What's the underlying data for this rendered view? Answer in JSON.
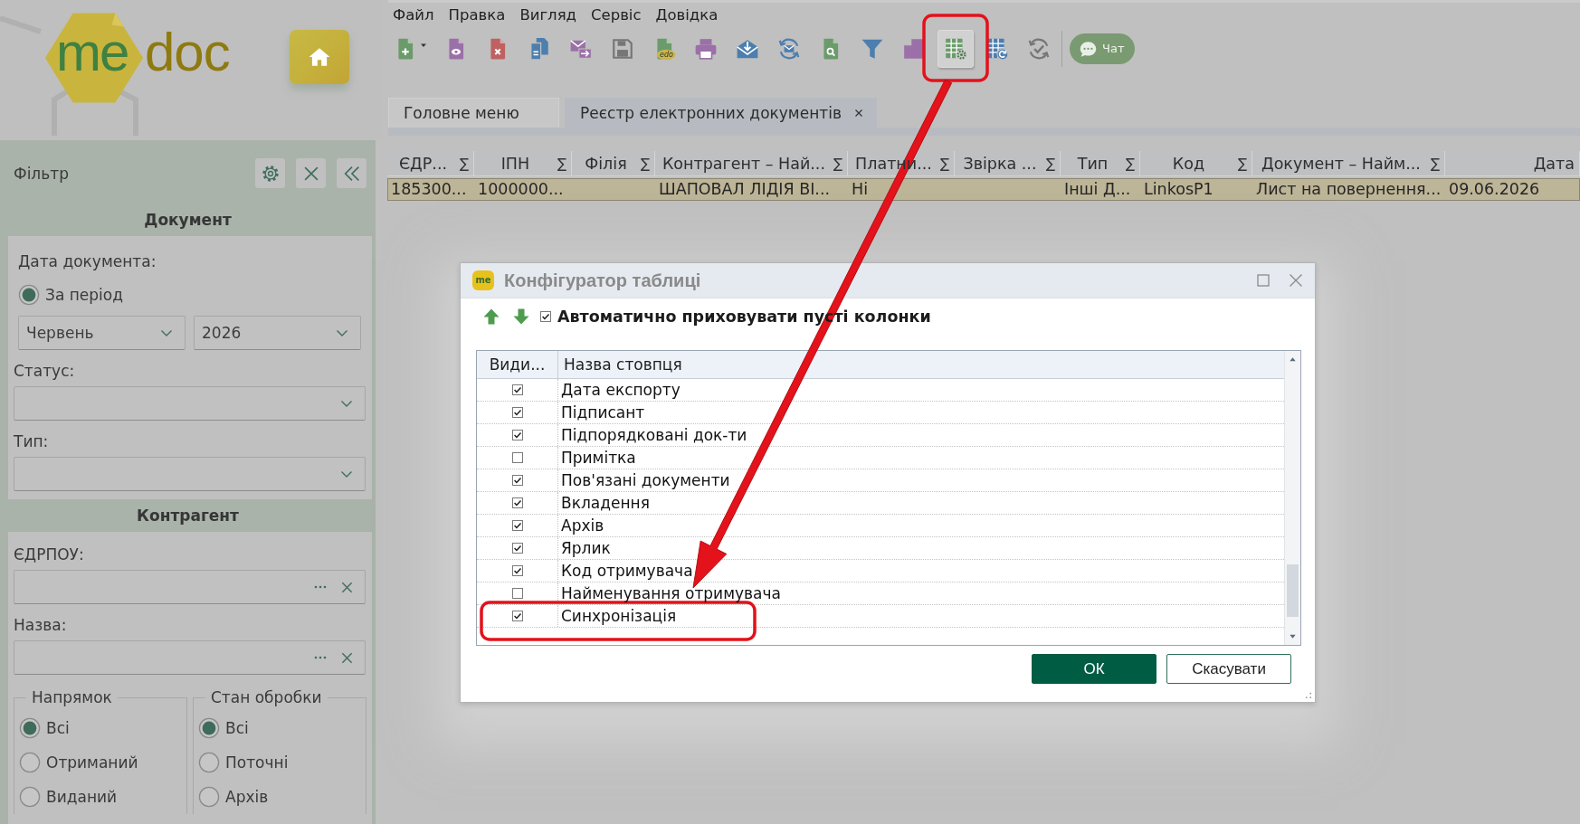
{
  "logo": {
    "primary": "me",
    "secondary": "doc"
  },
  "menu": [
    {
      "label": "Файл"
    },
    {
      "label": "Правка"
    },
    {
      "label": "Вигляд"
    },
    {
      "label": "Сервіс"
    },
    {
      "label": "Довідка"
    }
  ],
  "toolbar": [
    {
      "kind": "new-document",
      "pressed": false,
      "dropdown": true
    },
    {
      "kind": "view-document",
      "pressed": false,
      "dropdown": false
    },
    {
      "kind": "delete-document",
      "pressed": false,
      "dropdown": false
    },
    {
      "kind": "copy-document",
      "pressed": false,
      "dropdown": false
    },
    {
      "kind": "forward-mail",
      "pressed": false,
      "dropdown": false
    },
    {
      "kind": "save",
      "pressed": false,
      "dropdown": false
    },
    {
      "kind": "edo-document",
      "pressed": false,
      "dropdown": false,
      "label": "edo"
    },
    {
      "kind": "print",
      "pressed": false,
      "dropdown": false
    },
    {
      "kind": "receive-mail",
      "pressed": false,
      "dropdown": false
    },
    {
      "kind": "sync-mail",
      "pressed": false,
      "dropdown": false
    },
    {
      "kind": "find-document",
      "pressed": false,
      "dropdown": false
    },
    {
      "kind": "filter",
      "pressed": false,
      "dropdown": false
    },
    {
      "kind": "stack",
      "pressed": false,
      "dropdown": false
    },
    {
      "kind": "table-settings",
      "pressed": true,
      "dropdown": false
    },
    {
      "kind": "table-refresh",
      "pressed": false,
      "dropdown": false
    },
    {
      "kind": "sync-check",
      "pressed": false,
      "dropdown": false
    }
  ],
  "chat_button": {
    "label": "Чат"
  },
  "tabs": [
    {
      "label": "Головне меню",
      "selected": false,
      "closable": false
    },
    {
      "label": "Реєстр електронних документів",
      "selected": true,
      "closable": true
    }
  ],
  "filter": {
    "title": "Фільтр",
    "document_section": {
      "title": "Документ",
      "date_label": "Дата документа:",
      "period_option": {
        "label": "За період",
        "selected": true
      },
      "month_select": {
        "value": "Червень"
      },
      "year_select": {
        "value": "2026"
      },
      "status_select": {
        "label": "Статус:"
      },
      "type_select": {
        "label": "Тип:"
      }
    },
    "counterparty_section": {
      "title": "Контрагент",
      "edrpou_field": {
        "label": "ЄДРПОУ:"
      },
      "name_field": {
        "label": "Назва:"
      },
      "groups": [
        {
          "title": "Напрямок",
          "options": [
            {
              "label": "Всі",
              "selected": true
            },
            {
              "label": "Отриманий",
              "selected": false
            },
            {
              "label": "Виданий",
              "selected": false
            }
          ]
        },
        {
          "title": "Стан обробки",
          "options": [
            {
              "label": "Всі",
              "selected": true
            },
            {
              "label": "Поточні",
              "selected": false
            },
            {
              "label": "Архів",
              "selected": false
            }
          ]
        }
      ]
    }
  },
  "table": {
    "columns": [
      {
        "label": "ЄДР...",
        "sum": "∑"
      },
      {
        "label": "ІПН",
        "sum": "∑"
      },
      {
        "label": "Філія",
        "sum": "∑"
      },
      {
        "label": "Контрагент – Най...",
        "sum": "∑"
      },
      {
        "label": "Платни...",
        "sum": "∑"
      },
      {
        "label": "Звірка ...",
        "sum": "∑"
      },
      {
        "label": "Тип",
        "sum": "∑"
      },
      {
        "label": "Код",
        "sum": "∑"
      },
      {
        "label": "Документ – Найм...",
        "sum": "∑"
      },
      {
        "label": "Дата"
      }
    ],
    "rows": [
      {
        "selected": true,
        "cells": [
          "185300...",
          "1000000...",
          null,
          "ШАПОВАЛ ЛІДІЯ ВІ...",
          "Ні",
          null,
          "Інші Д...",
          "LinkosP1",
          "Лист на повернення...",
          "09.06.2026"
        ]
      }
    ]
  },
  "dialog": {
    "app_icon_label": "me",
    "title": "Конфігуратор таблиці",
    "auto_hide": {
      "label": "Автоматично приховувати пусті колонки",
      "checked": true
    },
    "grid": {
      "columns": [
        {
          "label": "Види..."
        },
        {
          "label": "Назва стовпця"
        }
      ],
      "rows": [
        {
          "name": "Дата експорту",
          "checked": true
        },
        {
          "name": "Підписант",
          "checked": true
        },
        {
          "name": "Підпорядковані док-ти",
          "checked": true
        },
        {
          "name": "Примітка",
          "checked": false
        },
        {
          "name": "Пов'язані документи",
          "checked": true
        },
        {
          "name": "Вкладення",
          "checked": true
        },
        {
          "name": "Архів",
          "checked": true
        },
        {
          "name": "Ярлик",
          "checked": true
        },
        {
          "name": "Код отримувача",
          "checked": true
        },
        {
          "name": "Найменування отримувача",
          "checked": false
        },
        {
          "name": "Синхронізація",
          "checked": true
        }
      ]
    },
    "buttons": [
      {
        "label": "ОК",
        "kind": "primary"
      },
      {
        "label": "Скасувати",
        "kind": "secondary"
      }
    ]
  }
}
